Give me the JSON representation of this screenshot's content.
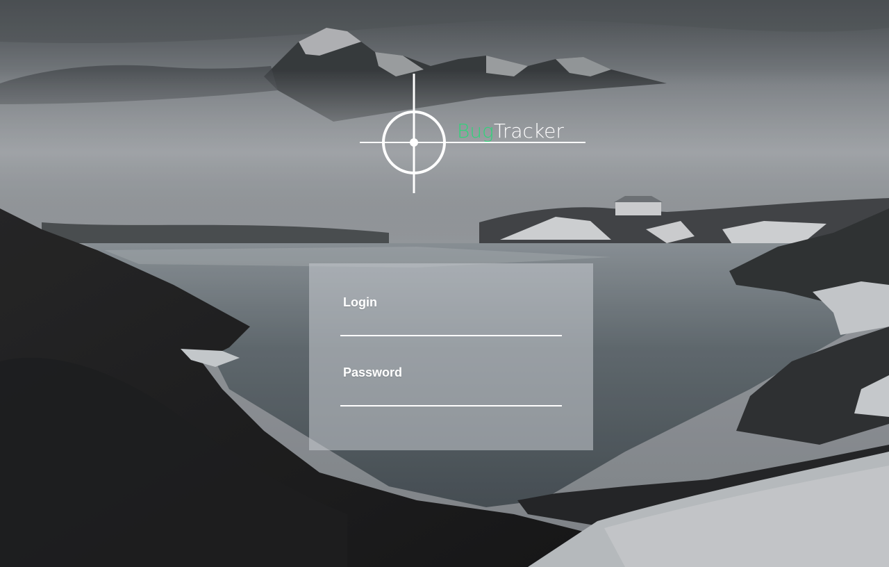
{
  "app": {
    "brand_prefix": "Bug",
    "brand_suffix": "Tracker",
    "accent_color": "#2ed47a",
    "logo_icon": "crosshair-icon"
  },
  "login_form": {
    "login_label": "Login",
    "login_value": "",
    "password_label": "Password",
    "password_value": ""
  },
  "background": {
    "description_icon": "mountain-lake-landscape-image"
  }
}
